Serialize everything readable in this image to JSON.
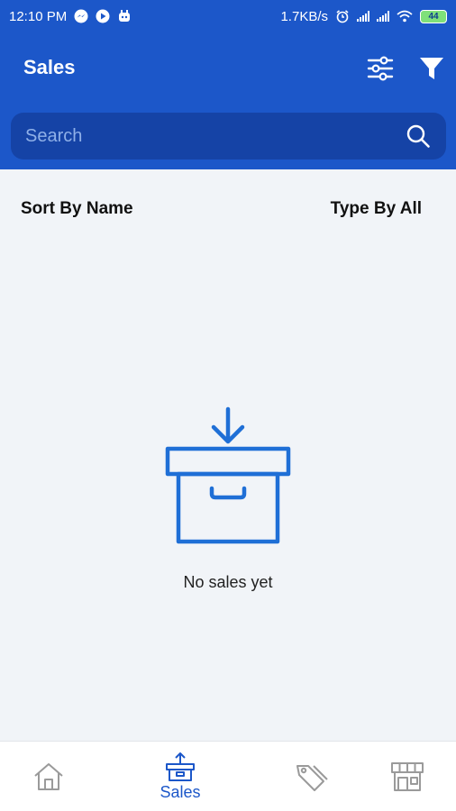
{
  "status_bar": {
    "time": "12:10 PM",
    "network_speed": "1.7KB/s",
    "battery": "44",
    "left_icons": [
      "messenger-icon",
      "play-icon",
      "notification-icon"
    ],
    "right_icons": [
      "alarm-icon",
      "signal-icon",
      "signal-icon",
      "wifi-icon",
      "battery-icon"
    ]
  },
  "header": {
    "title": "Sales",
    "actions": [
      "sliders-icon",
      "filter-icon"
    ]
  },
  "search": {
    "placeholder": "Search",
    "value": ""
  },
  "sort_bar": {
    "sort_label": "Sort By Name",
    "type_label": "Type By All"
  },
  "empty_state": {
    "icon": "empty-box-icon",
    "message": "No sales yet"
  },
  "bottom_nav": {
    "items": [
      {
        "icon": "home-icon",
        "label": "",
        "active": false
      },
      {
        "icon": "sales-icon",
        "label": "Sales",
        "active": true
      },
      {
        "icon": "tag-icon",
        "label": "",
        "active": false
      },
      {
        "icon": "store-icon",
        "label": "",
        "active": false
      }
    ]
  },
  "colors": {
    "primary": "#1c57c9",
    "search_bg": "#1543a6",
    "illustration": "#1f6fd6",
    "page_bg": "#f1f4f8",
    "nav_inactive": "#9a9a9a"
  }
}
